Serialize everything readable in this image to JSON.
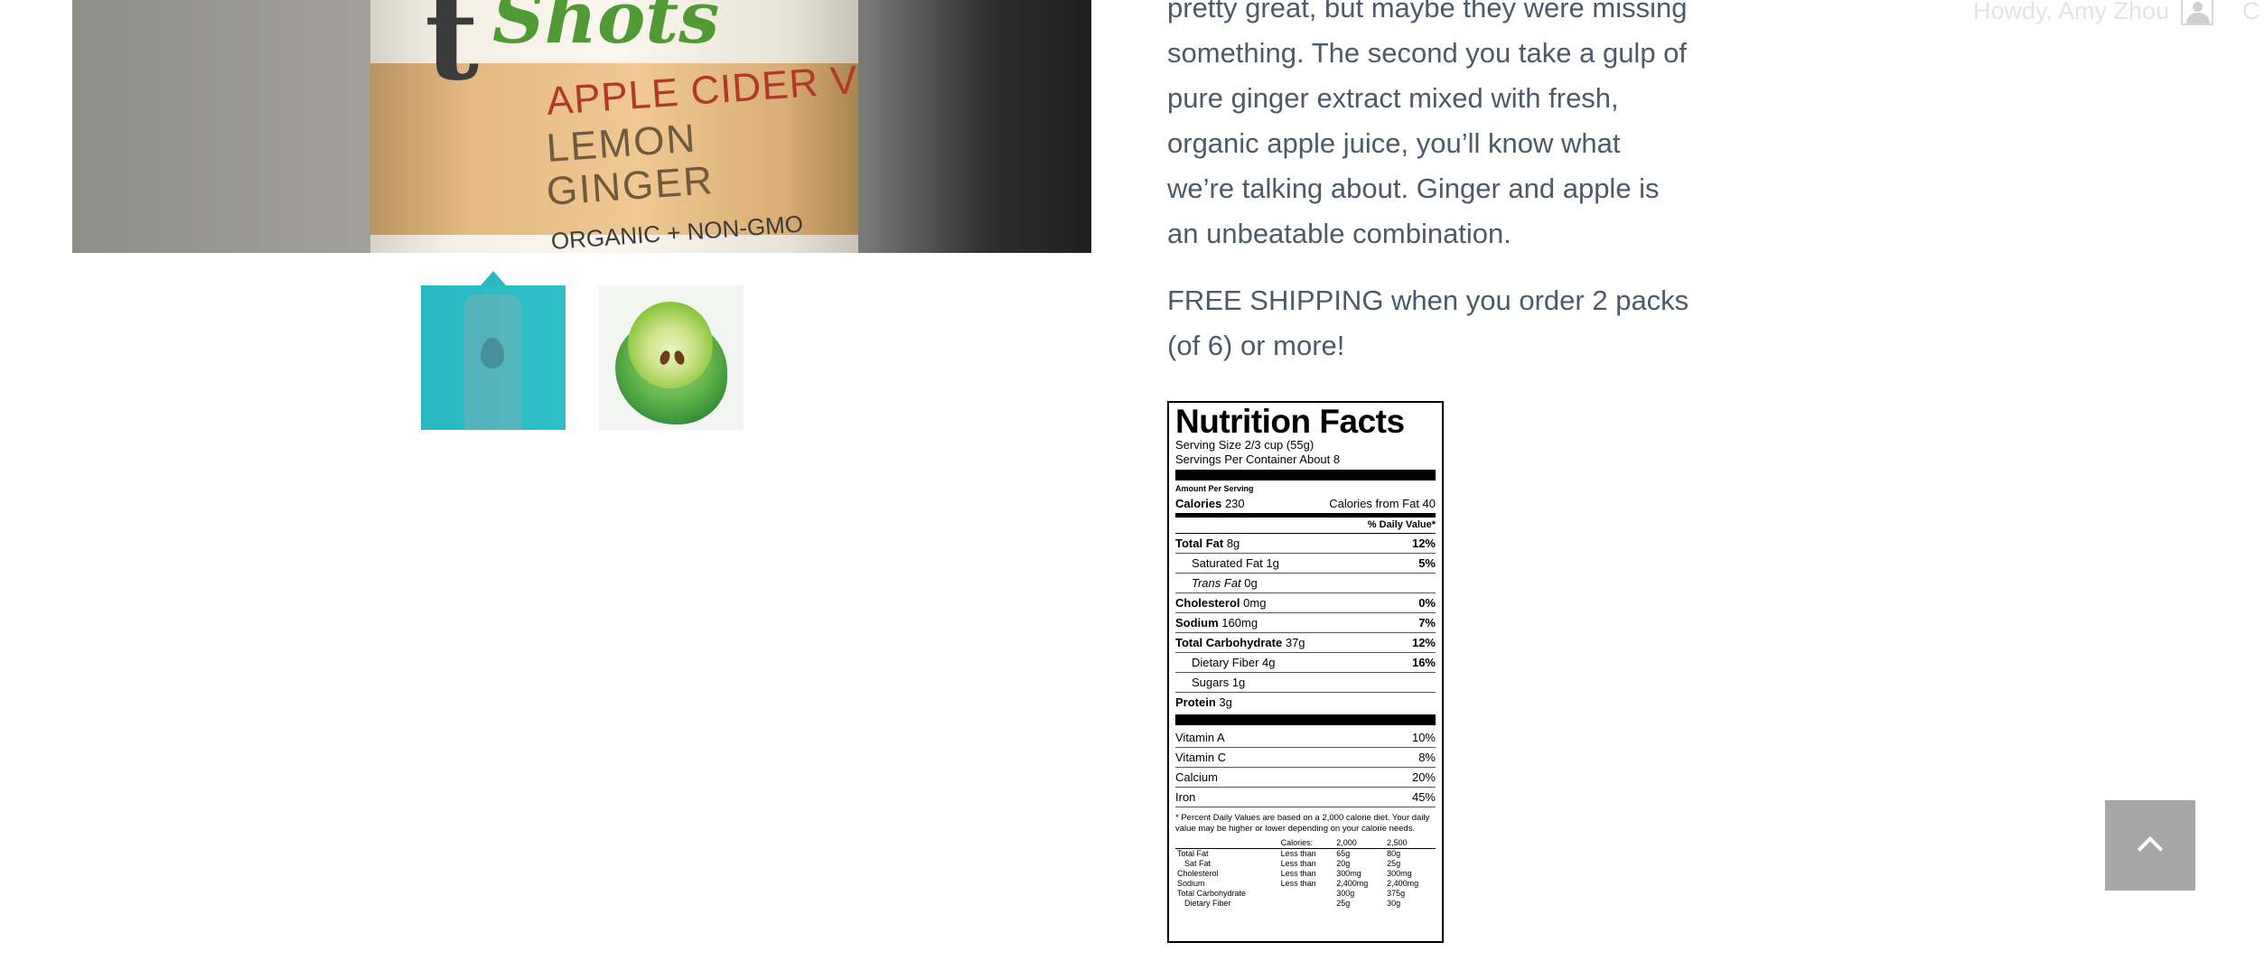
{
  "product": {
    "hero_image": {
      "logo_letter": "t",
      "logo_word": "Shots",
      "flavor_line1": "APPLE CIDER V",
      "flavor_line2": "LEMON",
      "flavor_line3": "GINGER",
      "flavor_line4": "ORGANIC + NON-GMO"
    },
    "thumbnails": [
      {
        "label": "tulua shot bottle thumbnail",
        "selected": true
      },
      {
        "label": "green apple thumbnail",
        "selected": false
      }
    ],
    "description": "pretty great, but maybe they were missing something. The second you take a gulp of pure ginger extract mixed with fresh, organic apple juice, you’ll know what we’re talking about. Ginger and apple is an unbeatable combination.",
    "shipping": "FREE SHIPPING when you order 2 packs (of 6) or more!"
  },
  "nutrition": {
    "title": "Nutrition Facts",
    "serving_size": "Serving Size 2/3 cup (55g)",
    "servings_per_container": "Servings Per Container About 8",
    "amount_per_serving": "Amount Per Serving",
    "calories_label": "Calories",
    "calories_value": "230",
    "calories_from_fat": "Calories from Fat 40",
    "daily_value_header": "% Daily Value*",
    "rows": [
      {
        "label": "Total Fat",
        "amount": "8g",
        "dv": "12%"
      },
      {
        "label": "Saturated Fat",
        "amount": "1g",
        "dv": "5%"
      },
      {
        "label": "Trans Fat",
        "amount": "0g",
        "dv": ""
      },
      {
        "label": "Cholesterol",
        "amount": "0mg",
        "dv": "0%"
      },
      {
        "label": "Sodium",
        "amount": "160mg",
        "dv": "7%"
      },
      {
        "label": "Total Carbohydrate",
        "amount": "37g",
        "dv": "12%"
      },
      {
        "label": "Dietary Fiber",
        "amount": "4g",
        "dv": "16%"
      },
      {
        "label": "Sugars",
        "amount": "1g",
        "dv": ""
      },
      {
        "label": "Protein",
        "amount": "3g",
        "dv": ""
      }
    ],
    "vitamins": [
      {
        "label": "Vitamin A",
        "dv": "10%"
      },
      {
        "label": "Vitamin C",
        "dv": "8%"
      },
      {
        "label": "Calcium",
        "dv": "20%"
      },
      {
        "label": "Iron",
        "dv": "45%"
      }
    ],
    "footnote": "* Percent Daily Values are based on a 2,000 calorie diet. Your daily value may be higher or lower depending on your calorie needs.",
    "table_head": [
      "",
      "Calories:",
      "2,000",
      "2,500"
    ],
    "table_rows": [
      [
        "Total Fat",
        "Less than",
        "65g",
        "80g"
      ],
      [
        "Sat Fat",
        "Less than",
        "20g",
        "25g"
      ],
      [
        "Cholesterol",
        "Less than",
        "300mg",
        "300mg"
      ],
      [
        "Sodium",
        "Less than",
        "2,400mg",
        "2,400mg"
      ],
      [
        "Total Carbohydrate",
        "",
        "300g",
        "375g"
      ],
      [
        "Dietary Fiber",
        "",
        "25g",
        "30g"
      ]
    ]
  },
  "header": {
    "greeting": "Howdy, Amy Zhou",
    "edge_glyph": "C"
  },
  "scroll_top": {
    "icon": "chevron-up-icon"
  },
  "colors": {
    "accent": "#27b8c0",
    "text": "#4d5a6a",
    "scroll_button": "#a7a7a7"
  }
}
